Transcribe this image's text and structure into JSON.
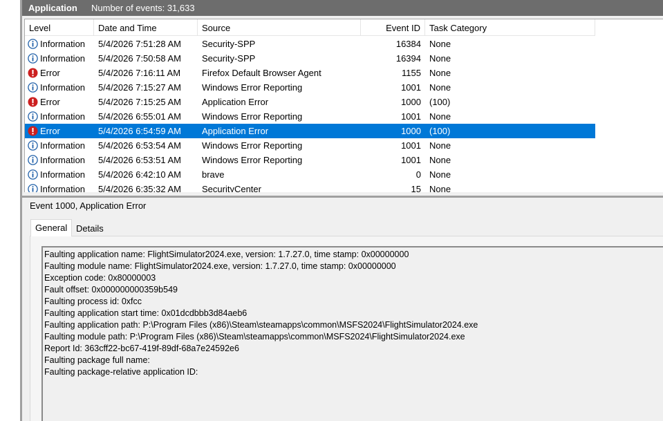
{
  "header": {
    "title": "Application",
    "count": "Number of events: 31,633"
  },
  "columns": [
    "Level",
    "Date and Time",
    "Source",
    "Event ID",
    "Task Category"
  ],
  "events": [
    {
      "level": "Information",
      "type": "info",
      "datetime": "5/4/2026 7:51:28 AM",
      "source": "Security-SPP",
      "event_id": "16384",
      "task": "None"
    },
    {
      "level": "Information",
      "type": "info",
      "datetime": "5/4/2026 7:50:58 AM",
      "source": "Security-SPP",
      "event_id": "16394",
      "task": "None"
    },
    {
      "level": "Error",
      "type": "error",
      "datetime": "5/4/2026 7:16:11 AM",
      "source": "Firefox Default Browser Agent",
      "event_id": "1155",
      "task": "None"
    },
    {
      "level": "Information",
      "type": "info",
      "datetime": "5/4/2026 7:15:27 AM",
      "source": "Windows Error Reporting",
      "event_id": "1001",
      "task": "None"
    },
    {
      "level": "Error",
      "type": "error",
      "datetime": "5/4/2026 7:15:25 AM",
      "source": "Application Error",
      "event_id": "1000",
      "task": "(100)"
    },
    {
      "level": "Information",
      "type": "info",
      "datetime": "5/4/2026 6:55:01 AM",
      "source": "Windows Error Reporting",
      "event_id": "1001",
      "task": "None"
    },
    {
      "level": "Error",
      "type": "error",
      "selected": true,
      "datetime": "5/4/2026 6:54:59 AM",
      "source": "Application Error",
      "event_id": "1000",
      "task": "(100)"
    },
    {
      "level": "Information",
      "type": "info",
      "datetime": "5/4/2026 6:53:54 AM",
      "source": "Windows Error Reporting",
      "event_id": "1001",
      "task": "None"
    },
    {
      "level": "Information",
      "type": "info",
      "datetime": "5/4/2026 6:53:51 AM",
      "source": "Windows Error Reporting",
      "event_id": "1001",
      "task": "None"
    },
    {
      "level": "Information",
      "type": "info",
      "datetime": "5/4/2026 6:42:10 AM",
      "source": "brave",
      "event_id": "0",
      "task": "None"
    },
    {
      "level": "Information",
      "type": "info",
      "datetime": "5/4/2026 6:35:32 AM",
      "source": "SecurityCenter",
      "event_id": "15",
      "task": "None"
    }
  ],
  "detail": {
    "title": "Event 1000, Application Error",
    "tabs": [
      "General",
      "Details"
    ],
    "lines": [
      "Faulting application name: FlightSimulator2024.exe, version: 1.7.27.0, time stamp: 0x00000000",
      "Faulting module name: FlightSimulator2024.exe, version: 1.7.27.0, time stamp: 0x00000000",
      "Exception code: 0x80000003",
      "Fault offset: 0x000000000359b549",
      "Faulting process id: 0xfcc",
      "Faulting application start time: 0x01dcdbbb3d84aeb6",
      "Faulting application path: P:\\Program Files (x86)\\Steam\\steamapps\\common\\MSFS2024\\FlightSimulator2024.exe",
      "Faulting module path: P:\\Program Files (x86)\\Steam\\steamapps\\common\\MSFS2024\\FlightSimulator2024.exe",
      "Report Id: 363cff22-bc67-419f-89df-68a7e24592e6",
      "Faulting package full name: ",
      "Faulting package-relative application ID: "
    ]
  },
  "colors": {
    "selection": "#0078d7",
    "info_icon": "#1f5fa8",
    "error_icon": "#cc1f1f",
    "header_bar": "#6d6d6d"
  },
  "icons": {
    "info": "information-icon",
    "error": "error-icon"
  }
}
